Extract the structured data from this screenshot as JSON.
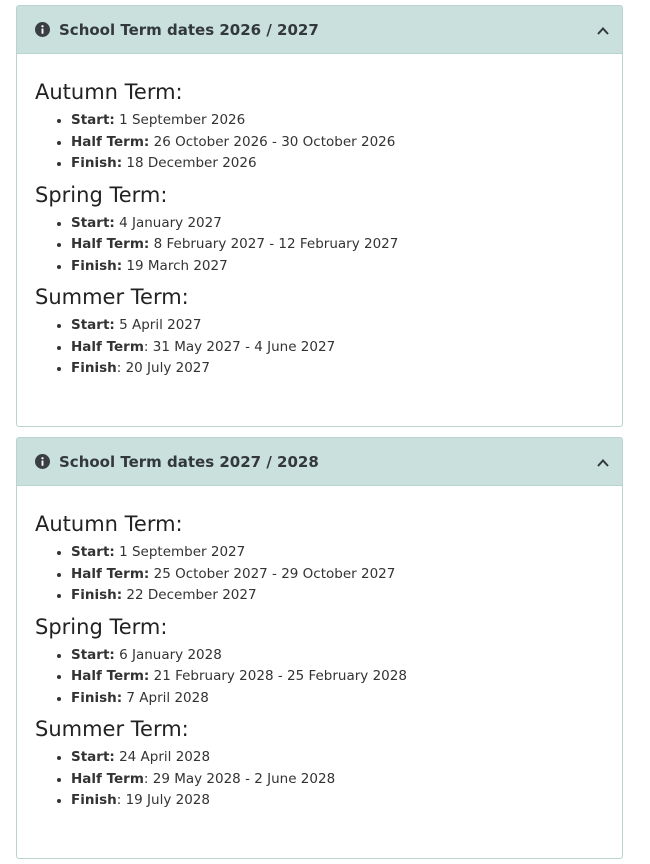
{
  "panels": [
    {
      "title": "School Term dates 2026 / 2027",
      "terms": [
        {
          "title": "Autumn Term:",
          "items": [
            {
              "label": "Start:",
              "value": " 1 September 2026"
            },
            {
              "label": "Half Term:",
              "value": " 26 October 2026 - 30 October 2026"
            },
            {
              "label": "Finish:",
              "value": " 18 December 2026"
            }
          ]
        },
        {
          "title": "Spring Term:",
          "items": [
            {
              "label": "Start:",
              "value": " 4 January 2027"
            },
            {
              "label": "Half Term:",
              "value": " 8 February 2027 - 12 February 2027"
            },
            {
              "label": "Finish:",
              "value": " 19 March 2027"
            }
          ]
        },
        {
          "title": "Summer Term:",
          "items": [
            {
              "label": "Start:",
              "value": " 5 April 2027"
            },
            {
              "label": "Half Term",
              "value": ": 31 May 2027 - 4 June 2027"
            },
            {
              "label": "Finish",
              "value": ": 20 July 2027"
            }
          ]
        }
      ]
    },
    {
      "title": "School Term dates 2027 / 2028",
      "terms": [
        {
          "title": "Autumn Term:",
          "items": [
            {
              "label": "Start:",
              "value": " 1 September 2027"
            },
            {
              "label": "Half Term:",
              "value": " 25 October 2027 - 29 October 2027"
            },
            {
              "label": "Finish:",
              "value": " 22 December 2027"
            }
          ]
        },
        {
          "title": "Spring Term:",
          "items": [
            {
              "label": "Start:",
              "value": " 6 January 2028"
            },
            {
              "label": "Half Term:",
              "value": " 21 February 2028 - 25 February 2028"
            },
            {
              "label": "Finish:",
              "value": " 7 April 2028"
            }
          ]
        },
        {
          "title": "Summer Term:",
          "items": [
            {
              "label": "Start:",
              "value": " 24 April 2028"
            },
            {
              "label": "Half Term",
              "value": ": 29 May 2028 - 2 June 2028"
            },
            {
              "label": "Finish",
              "value": ": 19 July 2028"
            }
          ]
        }
      ]
    }
  ],
  "icons": {
    "info": "info-circle-icon",
    "toggle": "chevron-up-icon"
  },
  "colors": {
    "header_bg": "#c9e0dd",
    "border": "#b9d3d1"
  }
}
